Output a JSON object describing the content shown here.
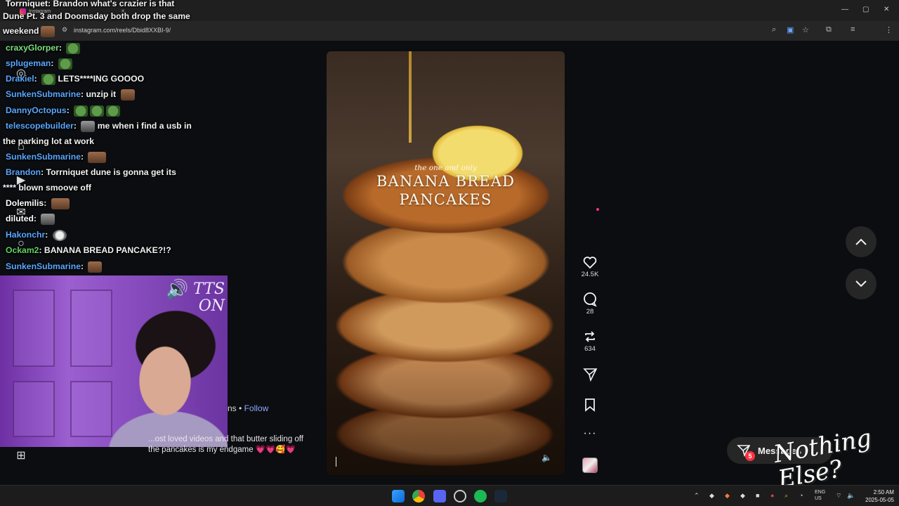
{
  "browser": {
    "tab_title": "Instagram",
    "url": "instagram.com/reels/Dbid8XXBI-9/"
  },
  "chat": {
    "messages": [
      {
        "user": "Torrniquet",
        "text": "Brandon what's crazier is that",
        "user_color": "#ffffff"
      },
      {
        "user": "",
        "text": "Dune Pt. 3 and Doomsday both drop the same",
        "user_color": "#ffffff"
      },
      {
        "user": "",
        "text": "weekend",
        "user_color": "#ffffff"
      },
      {
        "user": "craxyGlorper",
        "text": "",
        "user_color": "#7be07b"
      },
      {
        "user": "splugeman",
        "text": "",
        "user_color": "#5aa7ff"
      },
      {
        "user": "Drakiel",
        "text": "LETS****ING GOOOO",
        "user_color": "#5aa7ff"
      },
      {
        "user": "SunkenSubmarine",
        "text": "unzip it",
        "user_color": "#5aa7ff"
      },
      {
        "user": "DannyOctopus",
        "text": "",
        "user_color": "#5aa7ff"
      },
      {
        "user": "telescopebuilder",
        "text": "me when i find a usb in",
        "user_color": "#5aa7ff"
      },
      {
        "user": "",
        "text": "the parking lot at work",
        "user_color": "#ffffff"
      },
      {
        "user": "SunkenSubmarine",
        "text": "",
        "user_color": "#5aa7ff"
      },
      {
        "user": "Brandon",
        "text": "Torrniquet dune is gonna get its",
        "user_color": "#5aa7ff"
      },
      {
        "user": "",
        "text": "**** blown smoove off",
        "user_color": "#ffffff"
      },
      {
        "user": "Dolemilis",
        "text": "",
        "user_color": "#ffffff"
      },
      {
        "user": "diluted",
        "text": "",
        "user_color": "#ffffff"
      },
      {
        "user": "Hakonchr",
        "text": "",
        "user_color": "#5aa7ff"
      },
      {
        "user": "Ockam2",
        "text": "BANANA BREAD PANCAKE?!?",
        "user_color": "#5fd35f"
      },
      {
        "user": "SunkenSubmarine",
        "text": "",
        "user_color": "#5aa7ff"
      }
    ]
  },
  "overlay": {
    "tts_label": "TTS ON",
    "brand_text": "Nothing Else?"
  },
  "post": {
    "author_suffix": "ns",
    "follow_label": "Follow",
    "caption": "...ost loved videos and that butter sliding off the pancakes is my endgame 💗💗🥰💗"
  },
  "reel": {
    "subtitle": "the one and only",
    "title_line1": "BANANA BREAD",
    "title_line2": "PANCAKES"
  },
  "actions": {
    "likes": "24.5K",
    "comments": "28",
    "reposts": "634"
  },
  "messages": {
    "label": "Messages",
    "badge": "5"
  },
  "taskbar": {
    "lang": "ENG",
    "region": "US",
    "time": "2:50 AM",
    "date": "2025-05-05"
  },
  "colors": {
    "background": "#0b0d10",
    "accent_badge": "#ff3040",
    "link": "#8fa8ff"
  }
}
